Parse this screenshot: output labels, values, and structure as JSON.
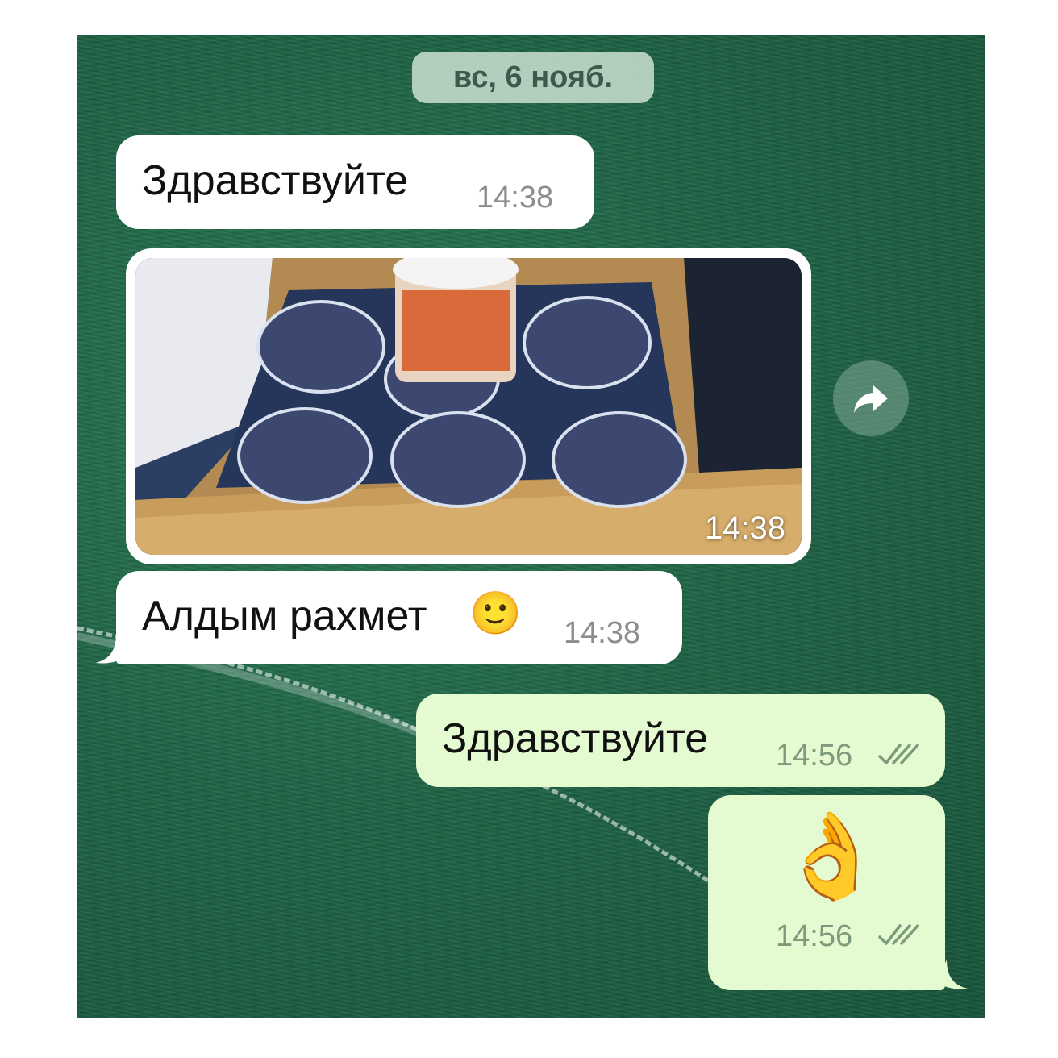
{
  "date_separator": "вс, 6 нояб.",
  "messages": [
    {
      "direction": "incoming",
      "text": "Здравствуйте",
      "time": "14:38"
    },
    {
      "direction": "incoming",
      "type": "photo",
      "time": "14:38"
    },
    {
      "direction": "incoming",
      "text": "Алдым рахмет",
      "emoji": "🙂",
      "time": "14:38"
    },
    {
      "direction": "outgoing",
      "text": "Здравствуйте",
      "time": "14:56",
      "status": "read"
    },
    {
      "direction": "outgoing",
      "type": "emoji",
      "emoji": "👌",
      "time": "14:56",
      "status": "read"
    }
  ],
  "icons": [
    "forward-icon",
    "double-check-icon"
  ],
  "colors": {
    "incoming_bubble": "#ffffff",
    "outgoing_bubble": "#e4fad0",
    "wallpaper": "#1f6446"
  }
}
